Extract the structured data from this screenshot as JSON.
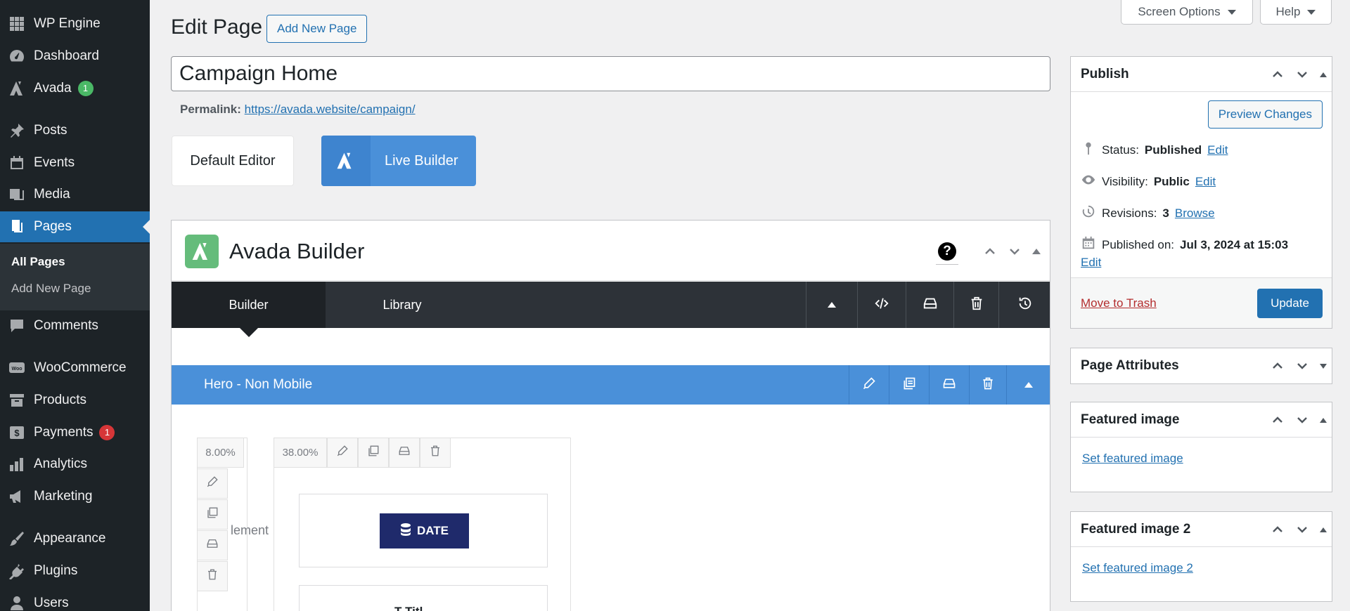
{
  "sidebar": {
    "items": [
      {
        "label": "WP Engine",
        "icon": "grid-icon"
      },
      {
        "label": "Dashboard",
        "icon": "dashboard-icon"
      },
      {
        "label": "Avada",
        "icon": "avada-icon",
        "badge": "1"
      },
      {
        "label": "Posts",
        "icon": "pin-icon"
      },
      {
        "label": "Events",
        "icon": "calendar-icon"
      },
      {
        "label": "Media",
        "icon": "media-icon"
      },
      {
        "label": "Pages",
        "icon": "pages-icon"
      },
      {
        "label": "Comments",
        "icon": "comment-icon"
      },
      {
        "label": "WooCommerce",
        "icon": "woo-icon"
      },
      {
        "label": "Products",
        "icon": "archive-icon"
      },
      {
        "label": "Payments",
        "icon": "dollar-icon",
        "badge": "1"
      },
      {
        "label": "Analytics",
        "icon": "chart-icon"
      },
      {
        "label": "Marketing",
        "icon": "megaphone-icon"
      },
      {
        "label": "Appearance",
        "icon": "brush-icon"
      },
      {
        "label": "Plugins",
        "icon": "plug-icon"
      },
      {
        "label": "Users",
        "icon": "user-icon"
      }
    ],
    "submenu": [
      "All Pages",
      "Add New Page"
    ]
  },
  "header": {
    "title": "Edit Page",
    "add_new": "Add New Page",
    "screen_options": "Screen Options",
    "help": "Help"
  },
  "post": {
    "title": "Campaign Home",
    "permalink_label": "Permalink:",
    "permalink_url": "https://avada.website/campaign/"
  },
  "editor_switch": {
    "default": "Default Editor",
    "live": "Live Builder"
  },
  "builder": {
    "title": "Avada Builder",
    "help": "?",
    "tabs": [
      "Builder",
      "Library"
    ],
    "section_label": "Hero - Non Mobile",
    "col1_width": "8.00%",
    "col2_width": "38.00%",
    "ghost_text": "lement",
    "date_label": "DATE",
    "title_partial": "Titl"
  },
  "publish": {
    "title": "Publish",
    "preview": "Preview Changes",
    "status_label": "Status:",
    "status_value": "Published",
    "visibility_label": "Visibility:",
    "visibility_value": "Public",
    "revisions_label": "Revisions:",
    "revisions_value": "3",
    "published_label": "Published on:",
    "published_value": "Jul 3, 2024 at 15:03",
    "edit": "Edit",
    "browse": "Browse",
    "trash": "Move to Trash",
    "update": "Update"
  },
  "page_attributes": {
    "title": "Page Attributes"
  },
  "featured_image": {
    "title": "Featured image",
    "link": "Set featured image"
  },
  "featured_image_2": {
    "title": "Featured image 2",
    "link": "Set featured image 2"
  },
  "colors": {
    "sidebar_bg": "#1d2327",
    "wp_blue": "#2271b1",
    "avada_blue": "#4a90d9",
    "avada_green": "#65bc7b",
    "date_navy": "#1f2a6b"
  }
}
